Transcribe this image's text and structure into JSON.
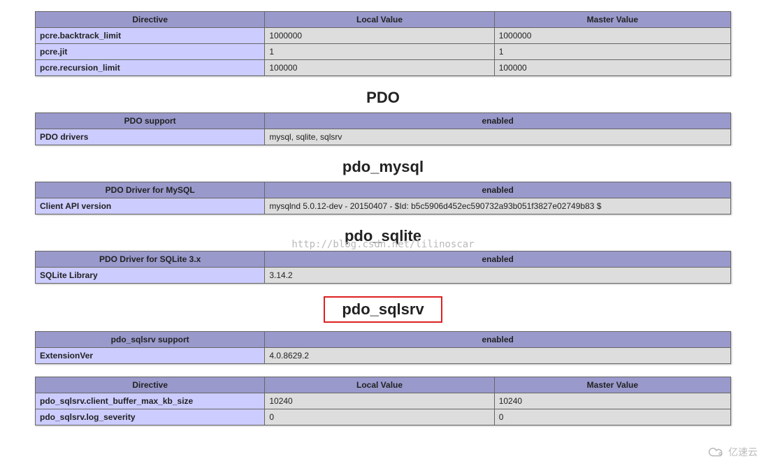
{
  "toptable": {
    "headers": [
      "Directive",
      "Local Value",
      "Master Value"
    ],
    "rows": [
      [
        "pcre.backtrack_limit",
        "1000000",
        "1000000"
      ],
      [
        "pcre.jit",
        "1",
        "1"
      ],
      [
        "pcre.recursion_limit",
        "100000",
        "100000"
      ]
    ]
  },
  "sections": {
    "pdo": {
      "title": "PDO",
      "table": {
        "headers": [
          "PDO support",
          "enabled"
        ],
        "rows": [
          [
            "PDO drivers",
            "mysql, sqlite, sqlsrv"
          ]
        ]
      }
    },
    "pdo_mysql": {
      "title": "pdo_mysql",
      "table": {
        "headers": [
          "PDO Driver for MySQL",
          "enabled"
        ],
        "rows": [
          [
            "Client API version",
            "mysqlnd 5.0.12-dev - 20150407 - $Id: b5c5906d452ec590732a93b051f3827e02749b83 $"
          ]
        ]
      }
    },
    "pdo_sqlite": {
      "title": "pdo_sqlite",
      "table": {
        "headers": [
          "PDO Driver for SQLite 3.x",
          "enabled"
        ],
        "rows": [
          [
            "SQLite Library",
            "3.14.2"
          ]
        ]
      }
    },
    "pdo_sqlsrv": {
      "title": "pdo_sqlsrv",
      "table1": {
        "headers": [
          "pdo_sqlsrv support",
          "enabled"
        ],
        "rows": [
          [
            "ExtensionVer",
            "4.0.8629.2"
          ]
        ]
      },
      "table2": {
        "headers": [
          "Directive",
          "Local Value",
          "Master Value"
        ],
        "rows": [
          [
            "pdo_sqlsrv.client_buffer_max_kb_size",
            "10240",
            "10240"
          ],
          [
            "pdo_sqlsrv.log_severity",
            "0",
            "0"
          ]
        ]
      }
    }
  },
  "watermark": "http://blog.csdn.net/lilinoscar",
  "logo_text": "亿速云"
}
